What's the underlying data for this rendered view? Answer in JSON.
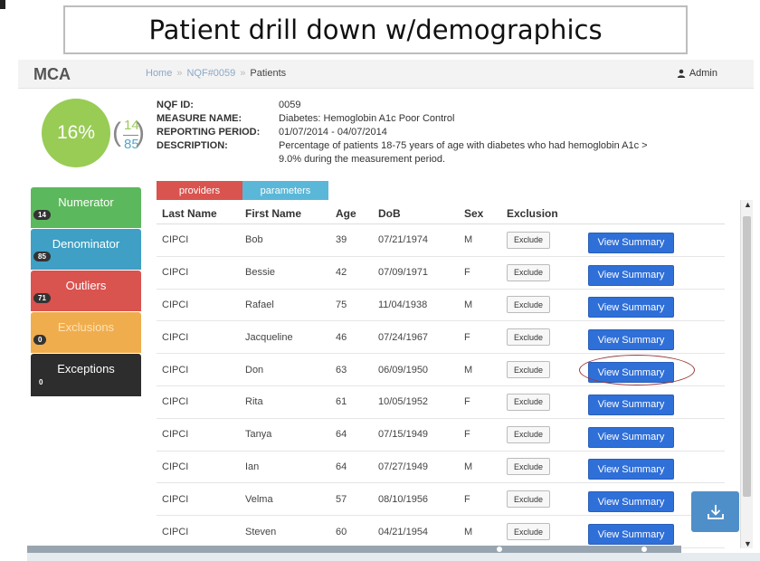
{
  "slide": {
    "title": "Patient drill down w/demographics"
  },
  "app": {
    "brand": "MCA",
    "breadcrumb": {
      "home": "Home",
      "separator": "»",
      "measure": "NQF#0059",
      "current": "Patients"
    },
    "user": {
      "label": "Admin",
      "icon": "user-icon"
    }
  },
  "score": {
    "percent": "16%",
    "numerator": "14",
    "denominator": "85"
  },
  "measure": {
    "id_label": "NQF ID:",
    "id_value": "0059",
    "name_label": "MEASURE NAME:",
    "name_value": "Diabetes: Hemoglobin A1c Poor Control",
    "period_label": "REPORTING PERIOD:",
    "period_value": "01/07/2014 - 04/07/2014",
    "desc_label": "DESCRIPTION:",
    "desc_value": "Percentage of patients 18-75 years of age with diabetes who had hemoglobin A1c > 9.0% during the measurement period."
  },
  "sidebar": {
    "items": [
      {
        "label": "Numerator",
        "count": "14",
        "color": "#5cb85c"
      },
      {
        "label": "Denominator",
        "count": "85",
        "color": "#3f9fc4"
      },
      {
        "label": "Outliers",
        "count": "71",
        "color": "#d9534f"
      },
      {
        "label": "Exclusions",
        "count": "0",
        "color": "#f0ad4e"
      },
      {
        "label": "Exceptions",
        "count": "0",
        "color": "#2d2d2d"
      }
    ]
  },
  "tabs": {
    "providers": "providers",
    "parameters": "parameters"
  },
  "table": {
    "headers": [
      "Last Name",
      "First Name",
      "Age",
      "DoB",
      "Sex",
      "Exclusion"
    ],
    "exclude_label": "Exclude",
    "summary_label": "View Summary",
    "rows": [
      [
        "CIPCI",
        "Bob",
        "39",
        "07/21/1974",
        "M"
      ],
      [
        "CIPCI",
        "Bessie",
        "42",
        "07/09/1971",
        "F"
      ],
      [
        "CIPCI",
        "Rafael",
        "75",
        "11/04/1938",
        "M"
      ],
      [
        "CIPCI",
        "Jacqueline",
        "46",
        "07/24/1967",
        "F"
      ],
      [
        "CIPCI",
        "Don",
        "63",
        "06/09/1950",
        "M"
      ],
      [
        "CIPCI",
        "Rita",
        "61",
        "10/05/1952",
        "F"
      ],
      [
        "CIPCI",
        "Tanya",
        "64",
        "07/15/1949",
        "F"
      ],
      [
        "CIPCI",
        "Ian",
        "64",
        "07/27/1949",
        "M"
      ],
      [
        "CIPCI",
        "Velma",
        "57",
        "08/10/1956",
        "F"
      ],
      [
        "CIPCI",
        "Steven",
        "60",
        "04/21/1954",
        "M"
      ]
    ]
  },
  "icons": {
    "download": "download-icon",
    "scroll_up": "chevron-up-icon",
    "scroll_down": "chevron-down-icon"
  },
  "colors": {
    "accent_blue": "#2f6fd8",
    "score_green": "#98cc55"
  }
}
